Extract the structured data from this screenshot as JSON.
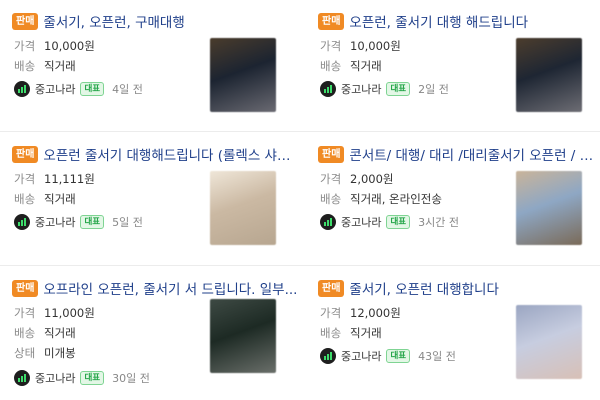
{
  "listings": [
    {
      "badge": "판매",
      "title": "줄서기, 오픈런, 구매대행",
      "price_label": "가격",
      "price": "10,000원",
      "delivery_label": "배송",
      "delivery": "직거래",
      "source": "중고나라",
      "rep_badge": "대표",
      "time": "4일 전",
      "thumb_colors": [
        "#1c2431",
        "#4a3c2c",
        "#6a6a72"
      ]
    },
    {
      "badge": "판매",
      "title": "오픈런, 줄서기 대행 해드립니다",
      "price_label": "가격",
      "price": "10,000원",
      "delivery_label": "배송",
      "delivery": "직거래",
      "source": "중고나라",
      "rep_badge": "대표",
      "time": "2일 전",
      "thumb_colors": [
        "#1e2633",
        "#4c3d2d",
        "#6d6d74"
      ]
    },
    {
      "badge": "판매",
      "title": "오픈런 줄서기 대행해드립니다 (롤렉스 샤넬...",
      "price_label": "가격",
      "price": "11,111원",
      "delivery_label": "배송",
      "delivery": "직거래",
      "source": "중고나라",
      "rep_badge": "대표",
      "time": "5일 전",
      "thumb_colors": [
        "#cbb9a3",
        "#efe6d8",
        "#b7a690"
      ]
    },
    {
      "badge": "판매",
      "title": "콘서트/ 대행/ 대리 /대리줄서기 오픈런 / 줄...",
      "price_label": "가격",
      "price": "2,000원",
      "delivery_label": "배송",
      "delivery": "직거래, 온라인전송",
      "source": "중고나라",
      "rep_badge": "대표",
      "time": "3시간 전",
      "thumb_colors": [
        "#8ea7c4",
        "#c9b49a",
        "#7a6a58"
      ]
    },
    {
      "badge": "판매",
      "title": "오프라인 오픈런, 줄서기 서 드립니다. 일부...",
      "price_label": "가격",
      "price": "11,000원",
      "delivery_label": "배송",
      "delivery": "직거래",
      "status_label": "상태",
      "status": "미개봉",
      "source": "중고나라",
      "rep_badge": "대표",
      "time": "30일 전",
      "thumb_colors": [
        "#1d2a24",
        "#3e4a44",
        "#6a6f6a"
      ]
    },
    {
      "badge": "판매",
      "title": "줄서기, 오픈런 대행합니다",
      "price_label": "가격",
      "price": "12,000원",
      "delivery_label": "배송",
      "delivery": "직거래",
      "source": "중고나라",
      "rep_badge": "대표",
      "time": "43일 전",
      "thumb_colors": [
        "#c7cde0",
        "#9ba6c2",
        "#d8c0b6"
      ]
    }
  ],
  "colors": {
    "badge_bg": "#f08a24",
    "title": "#1f3f8a",
    "rep_badge": "#22a447",
    "source_icon": "#1e1e1e"
  },
  "icons": {
    "source": "junggonara-logo-icon",
    "rep": "verified-rep-badge"
  }
}
